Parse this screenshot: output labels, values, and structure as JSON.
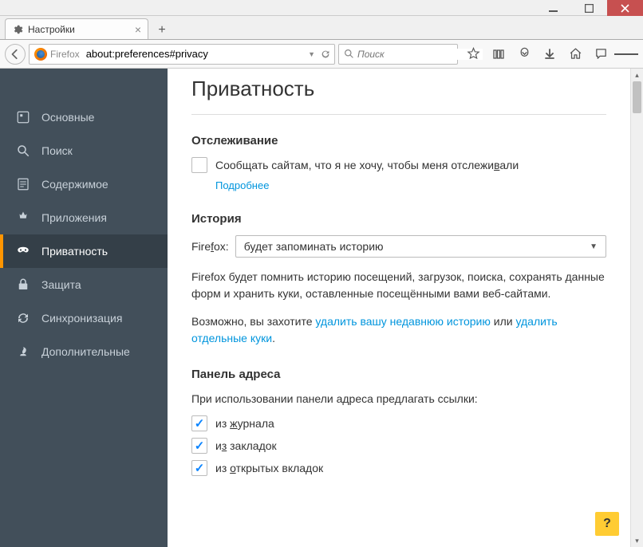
{
  "window": {
    "tab_title": "Настройки",
    "identity_label": "Firefox",
    "url": "about:preferences#privacy",
    "search_placeholder": "Поиск"
  },
  "sidebar": {
    "items": [
      {
        "label": "Основные"
      },
      {
        "label": "Поиск"
      },
      {
        "label": "Содержимое"
      },
      {
        "label": "Приложения"
      },
      {
        "label": "Приватность"
      },
      {
        "label": "Защита"
      },
      {
        "label": "Синхронизация"
      },
      {
        "label": "Дополнительные"
      }
    ]
  },
  "page": {
    "title": "Приватность",
    "tracking": {
      "heading": "Отслеживание",
      "checkbox_label_pre": "Сообщать сайтам, что я не хочу, чтобы меня отслежи",
      "checkbox_label_u": "в",
      "checkbox_label_post": "али",
      "more_link": "Подробнее"
    },
    "history": {
      "heading": "История",
      "select_label_pre": "Fire",
      "select_label_u": "f",
      "select_label_post": "ox:",
      "select_value": "будет запоминать историю",
      "desc": "Firefox будет помнить историю посещений, загрузок, поиска, сохранять данные форм и хранить куки, оставленные посещёнными вами веб-сайтами.",
      "maybe_pre": "Возможно, вы захотите ",
      "clear_history_link": "удалить вашу недавнюю историю",
      "maybe_mid": " или ",
      "clear_cookies_link": "удалить отдельные куки",
      "maybe_post": "."
    },
    "locationbar": {
      "heading": "Панель адреса",
      "intro": "При использовании панели адреса предлагать ссылки:",
      "opt1_pre": "из ",
      "opt1_u": "ж",
      "opt1_post": "урнала",
      "opt2_pre": "и",
      "opt2_u": "з",
      "opt2_post": " закладок",
      "opt3_pre": "из ",
      "opt3_u": "о",
      "opt3_post": "ткрытых вкладок"
    },
    "help": "?"
  }
}
